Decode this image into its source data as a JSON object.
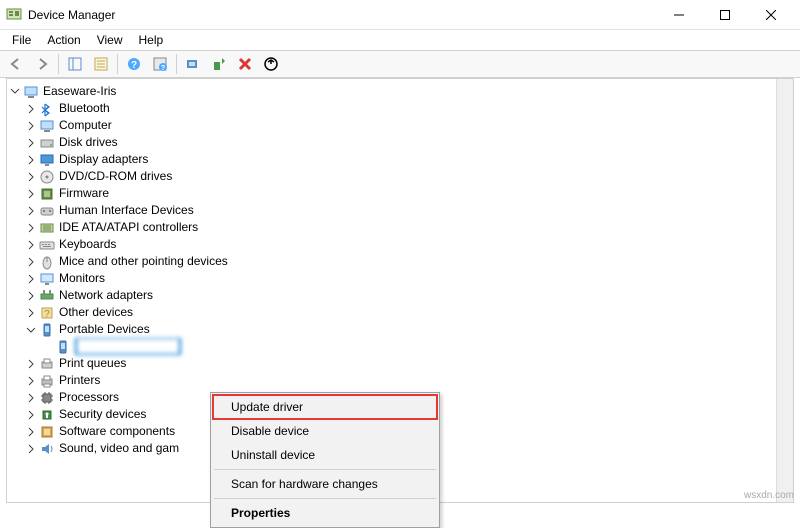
{
  "window": {
    "title": "Device Manager"
  },
  "menu": {
    "file": "File",
    "action": "Action",
    "view": "View",
    "help": "Help"
  },
  "root": {
    "label": "Easeware-Iris"
  },
  "nodes": [
    {
      "label": "Bluetooth",
      "icon": "bluetooth"
    },
    {
      "label": "Computer",
      "icon": "computer"
    },
    {
      "label": "Disk drives",
      "icon": "disk"
    },
    {
      "label": "Display adapters",
      "icon": "display"
    },
    {
      "label": "DVD/CD-ROM drives",
      "icon": "cdrom"
    },
    {
      "label": "Firmware",
      "icon": "firmware"
    },
    {
      "label": "Human Interface Devices",
      "icon": "hid"
    },
    {
      "label": "IDE ATA/ATAPI controllers",
      "icon": "ide"
    },
    {
      "label": "Keyboards",
      "icon": "keyboard"
    },
    {
      "label": "Mice and other pointing devices",
      "icon": "mouse"
    },
    {
      "label": "Monitors",
      "icon": "monitor"
    },
    {
      "label": "Network adapters",
      "icon": "network"
    },
    {
      "label": "Other devices",
      "icon": "other"
    },
    {
      "label": "Portable Devices",
      "icon": "portable",
      "expanded": true
    },
    {
      "label": "Print queues",
      "icon": "printq"
    },
    {
      "label": "Printers",
      "icon": "printer"
    },
    {
      "label": "Processors",
      "icon": "cpu"
    },
    {
      "label": "Security devices",
      "icon": "security"
    },
    {
      "label": "Software components",
      "icon": "software"
    },
    {
      "label": "Sound, video and gam",
      "icon": "sound"
    }
  ],
  "selected_device": "████████████",
  "context_menu": {
    "update": "Update driver",
    "disable": "Disable device",
    "uninstall": "Uninstall device",
    "scan": "Scan for hardware changes",
    "properties": "Properties"
  },
  "watermark": "wsxdn.com"
}
